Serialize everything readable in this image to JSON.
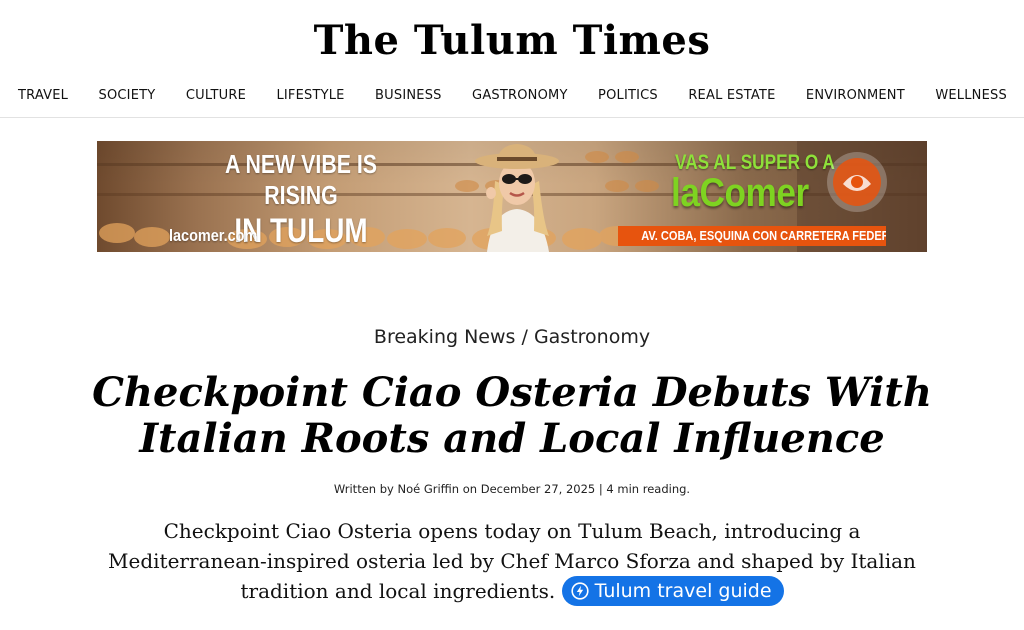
{
  "site": {
    "title": "The Tulum Times"
  },
  "nav": {
    "items": [
      {
        "label": "TRAVEL"
      },
      {
        "label": "SOCIETY"
      },
      {
        "label": "CULTURE"
      },
      {
        "label": "LIFESTYLE"
      },
      {
        "label": "BUSINESS"
      },
      {
        "label": "GASTRONOMY"
      },
      {
        "label": "POLITICS"
      },
      {
        "label": "REAL ESTATE"
      },
      {
        "label": "ENVIRONMENT"
      },
      {
        "label": "WELLNESS"
      }
    ]
  },
  "ad": {
    "headline_line1": "A NEW VIBE IS RISING",
    "headline_line2": "IN TULUM",
    "url": "lacomer.com",
    "slogan": "VAS AL SUPER O A",
    "brand": "laComer",
    "address": "AV. COBA, ESQUINA CON CARRETERA FEDERAL",
    "colors": {
      "brand_green": "#7ed321",
      "address_orange": "#e7540e"
    }
  },
  "article": {
    "breadcrumb": {
      "section": "Breaking News",
      "separator": "/",
      "category": "Gastronomy"
    },
    "headline_line1": "Checkpoint Ciao Osteria Debuts With",
    "headline_line2": "Italian Roots and Local Influence",
    "byline": "Written by Noé Griffin on December 27, 2025 | 4 min reading.",
    "summary": "Checkpoint Ciao Osteria opens today on Tulum Beach, introducing a Mediterranean-inspired osteria led by Chef Marco Sforza and shaped by Italian tradition and local ingredients.",
    "guide_link": {
      "label": "Tulum travel guide",
      "icon": "bolt-icon",
      "color": "#1473e6"
    }
  }
}
